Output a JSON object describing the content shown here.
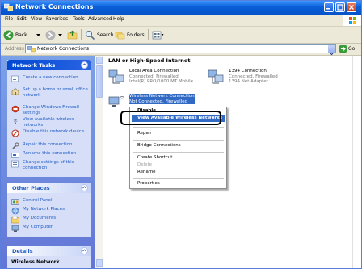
{
  "window": {
    "title": "Network Connections"
  },
  "menu": [
    "File",
    "Edit",
    "View",
    "Favorites",
    "Tools",
    "Advanced",
    "Help"
  ],
  "toolbar": {
    "back_label": "Back",
    "search_label": "Search",
    "folders_label": "Folders"
  },
  "address": {
    "label": "Address",
    "value": "Network Connections",
    "go_label": "Go"
  },
  "sidebar": {
    "network_tasks": {
      "title": "Network Tasks",
      "items": [
        "Create a new connection",
        "Set up a home or small office network",
        "Change Windows Firewall settings",
        "View available wireless networks",
        "Disable this network device",
        "Repair this connection",
        "Rename this connection",
        "Change settings of this connection"
      ]
    },
    "other_places": {
      "title": "Other Places",
      "items": [
        "Control Panel",
        "My Network Places",
        "My Documents",
        "My Computer"
      ]
    },
    "details": {
      "title": "Details",
      "first_item": "Wireless Network"
    }
  },
  "content": {
    "group_title": "LAN or High-Speed Internet",
    "connections": [
      {
        "name": "Local Area Connection",
        "status": "Connected, Firewalled",
        "device": "Intel(R) PRO/1000 MT Mobile ..."
      },
      {
        "name": "1394 Connection",
        "status": "Connected, Firewalled",
        "device": "1394 Net Adapter"
      },
      {
        "name": "Wireless Network Connection",
        "status": "Not Connected, Firewalled"
      }
    ]
  },
  "context_menu": {
    "items": [
      "Disable",
      "View Available Wireless Networks",
      "Repair",
      "Bridge Connections",
      "Create Shortcut",
      "Delete",
      "Rename",
      "Properties"
    ],
    "highlighted": "View Available Wireless Networks",
    "disabled": [
      "Delete"
    ]
  },
  "colors": {
    "titlebar": "#0a5fd8",
    "selection": "#316ac5",
    "task_link": "#215dc6"
  }
}
